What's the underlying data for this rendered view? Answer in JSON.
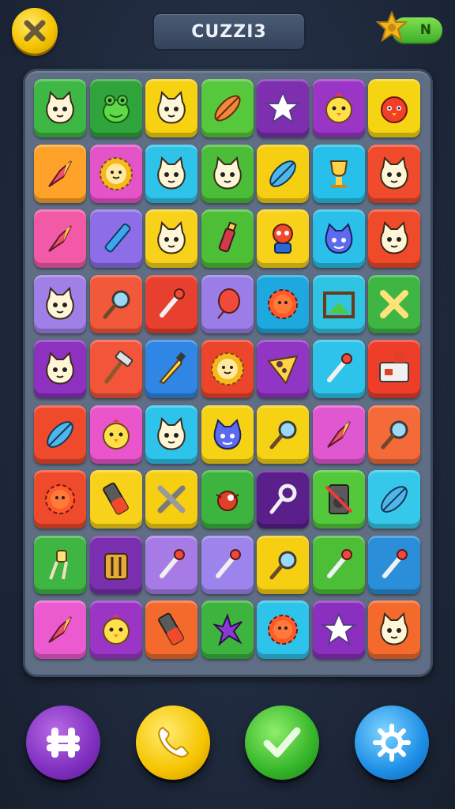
{
  "header": {
    "title": "CUZZI3",
    "badge_label": "N"
  },
  "colors": {
    "background": "#1f2b40",
    "board": "#5f6e84",
    "close_button": "#f5c400",
    "badge": "#3fae2c"
  },
  "board": {
    "rows": 9,
    "cols": 7,
    "tiles": [
      {
        "color": "#3eb845",
        "icon": "cat-face"
      },
      {
        "color": "#2fa43a",
        "icon": "frog-face"
      },
      {
        "color": "#f6d210",
        "icon": "cat-face"
      },
      {
        "color": "#55c83b",
        "icon": "feather"
      },
      {
        "color": "#7d2fb0",
        "icon": "star"
      },
      {
        "color": "#9a35c6",
        "icon": "chick-face"
      },
      {
        "color": "#f5d412",
        "icon": "bird-face"
      },
      {
        "color": "#ffa22a",
        "icon": "crystal"
      },
      {
        "color": "#e553c8",
        "icon": "sun-face"
      },
      {
        "color": "#2ec4ea",
        "icon": "cat-face"
      },
      {
        "color": "#4bbd38",
        "icon": "cat-face"
      },
      {
        "color": "#f6cf12",
        "icon": "leaf"
      },
      {
        "color": "#27c0ea",
        "icon": "trophy"
      },
      {
        "color": "#f04b2c",
        "icon": "cat-face"
      },
      {
        "color": "#f25aa8",
        "icon": "crystal"
      },
      {
        "color": "#8e6ee8",
        "icon": "pencil"
      },
      {
        "color": "#f8d21a",
        "icon": "cat-face"
      },
      {
        "color": "#4cbf37",
        "icon": "bottle"
      },
      {
        "color": "#f8d21a",
        "icon": "robot"
      },
      {
        "color": "#2ac0ea",
        "icon": "monster-face"
      },
      {
        "color": "#ef4a2a",
        "icon": "cat-face"
      },
      {
        "color": "#a07fe6",
        "icon": "cat-face"
      },
      {
        "color": "#f2593a",
        "icon": "magnifier"
      },
      {
        "color": "#e8402e",
        "icon": "brush"
      },
      {
        "color": "#9a7de6",
        "icon": "balloon"
      },
      {
        "color": "#1ea8e0",
        "icon": "gear"
      },
      {
        "color": "#30c4e4",
        "icon": "frame"
      },
      {
        "color": "#3fb644",
        "icon": "bone"
      },
      {
        "color": "#8e30c0",
        "icon": "cat-face"
      },
      {
        "color": "#f2553a",
        "icon": "hammer"
      },
      {
        "color": "#2f86e4",
        "icon": "knife"
      },
      {
        "color": "#ec452c",
        "icon": "sun-face"
      },
      {
        "color": "#9135c4",
        "icon": "cheese"
      },
      {
        "color": "#2ec3ea",
        "icon": "brush"
      },
      {
        "color": "#ee3e2a",
        "icon": "radio"
      },
      {
        "color": "#f04a2c",
        "icon": "leaf"
      },
      {
        "color": "#ea55cc",
        "icon": "chick-face"
      },
      {
        "color": "#2ec3ea",
        "icon": "cat-face"
      },
      {
        "color": "#f6d214",
        "icon": "monster-face"
      },
      {
        "color": "#f6d214",
        "icon": "magnifier"
      },
      {
        "color": "#e058d0",
        "icon": "crystal"
      },
      {
        "color": "#f46a38",
        "icon": "magnifier"
      },
      {
        "color": "#f04a2c",
        "icon": "gear"
      },
      {
        "color": "#f8d21a",
        "icon": "battery"
      },
      {
        "color": "#f6cf12",
        "icon": "cross-tools"
      },
      {
        "color": "#3cb43e",
        "icon": "bug"
      },
      {
        "color": "#5a1f8a",
        "icon": "key"
      },
      {
        "color": "#52c83a",
        "icon": "speaker"
      },
      {
        "color": "#36c8ea",
        "icon": "leaf"
      },
      {
        "color": "#3fb644",
        "icon": "torch"
      },
      {
        "color": "#7a2fae",
        "icon": "cage"
      },
      {
        "color": "#a77be6",
        "icon": "brush"
      },
      {
        "color": "#9d84ec",
        "icon": "brush"
      },
      {
        "color": "#f6cf12",
        "icon": "magnifier"
      },
      {
        "color": "#4cbf37",
        "icon": "brush"
      },
      {
        "color": "#2a8ed8",
        "icon": "brush"
      },
      {
        "color": "#ec5ad0",
        "icon": "crystal"
      },
      {
        "color": "#9a35c6",
        "icon": "chick-face"
      },
      {
        "color": "#f46a2c",
        "icon": "battery"
      },
      {
        "color": "#3cb43e",
        "icon": "splat"
      },
      {
        "color": "#2ec3ea",
        "icon": "gear"
      },
      {
        "color": "#8a2fbe",
        "icon": "star"
      },
      {
        "color": "#f46a2c",
        "icon": "cat-face"
      }
    ]
  },
  "actions": [
    {
      "name": "grid-button",
      "icon": "grid-icon"
    },
    {
      "name": "call-button",
      "icon": "phone-icon"
    },
    {
      "name": "check-button",
      "icon": "check-icon"
    },
    {
      "name": "settings-button",
      "icon": "gear-icon"
    }
  ]
}
